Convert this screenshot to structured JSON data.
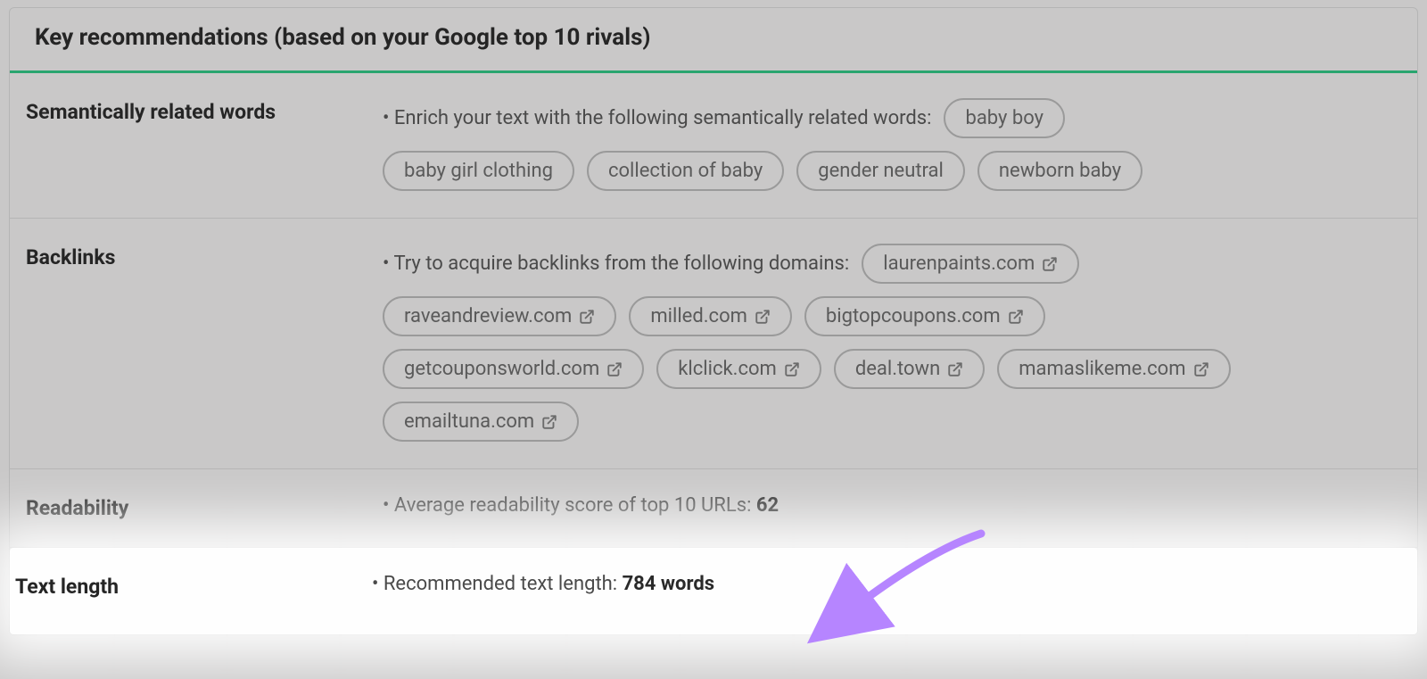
{
  "header": {
    "title": "Key recommendations (based on your Google top 10 rivals)"
  },
  "rows": {
    "semantic": {
      "label": "Semantically related words",
      "intro": "• Enrich your text with the following semantically related words:",
      "terms": [
        "baby boy",
        "baby girl clothing",
        "collection of baby",
        "gender neutral",
        "newborn baby"
      ]
    },
    "backlinks": {
      "label": "Backlinks",
      "intro": "• Try to acquire backlinks from the following domains:",
      "domains": [
        "laurenpaints.com",
        "raveandreview.com",
        "milled.com",
        "bigtopcoupons.com",
        "getcouponsworld.com",
        "klclick.com",
        "deal.town",
        "mamaslikeme.com",
        "emailtuna.com"
      ]
    },
    "readability": {
      "label": "Readability",
      "line_prefix": "• Average readability score of top 10 URLs: ",
      "score": "62"
    },
    "textlength": {
      "label": "Text length",
      "line_prefix": "• Recommended text length: ",
      "value": "784 words"
    }
  }
}
